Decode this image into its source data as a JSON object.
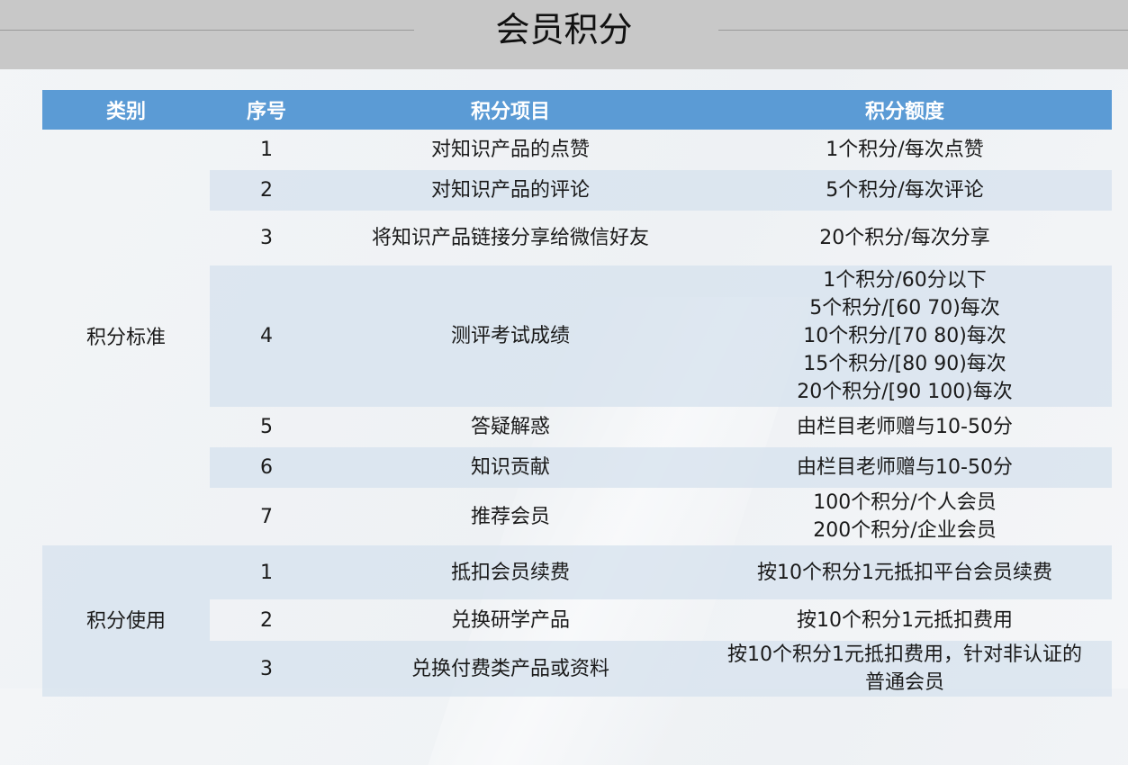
{
  "title": "会员积分",
  "headers": [
    "类别",
    "序号",
    "积分项目",
    "积分额度"
  ],
  "categories": [
    "积分标准",
    "积分使用"
  ],
  "standard_rows": [
    {
      "no": "1",
      "item": "对知识产品的点赞",
      "amount": [
        "1个积分/每次点赞"
      ]
    },
    {
      "no": "2",
      "item": "对知识产品的评论",
      "amount": [
        "5个积分/每次评论"
      ]
    },
    {
      "no": "3",
      "item": "将知识产品链接分享给微信好友",
      "amount": [
        "20个积分/每次分享"
      ]
    },
    {
      "no": "4",
      "item": "测评考试成绩",
      "amount": [
        "1个积分/60分以下",
        "5个积分/[60 70)每次",
        "10个积分/[70 80)每次",
        "15个积分/[80 90)每次",
        "20个积分/[90 100)每次"
      ]
    },
    {
      "no": "5",
      "item": "答疑解惑",
      "amount": [
        "由栏目老师赠与10-50分"
      ]
    },
    {
      "no": "6",
      "item": "知识贡献",
      "amount": [
        "由栏目老师赠与10-50分"
      ]
    },
    {
      "no": "7",
      "item": "推荐会员",
      "amount": [
        "100个积分/个人会员",
        "200个积分/企业会员"
      ]
    }
  ],
  "usage_rows": [
    {
      "no": "1",
      "item": "抵扣会员续费",
      "amount": [
        "按10个积分1元抵扣平台会员续费"
      ]
    },
    {
      "no": "2",
      "item": "兑换研学产品",
      "amount": [
        "按10个积分1元抵扣费用"
      ]
    },
    {
      "no": "3",
      "item": "兑换付费类产品或资料",
      "amount": [
        "按10个积分1元抵扣费用，针对非认证的",
        "普通会员"
      ]
    }
  ]
}
